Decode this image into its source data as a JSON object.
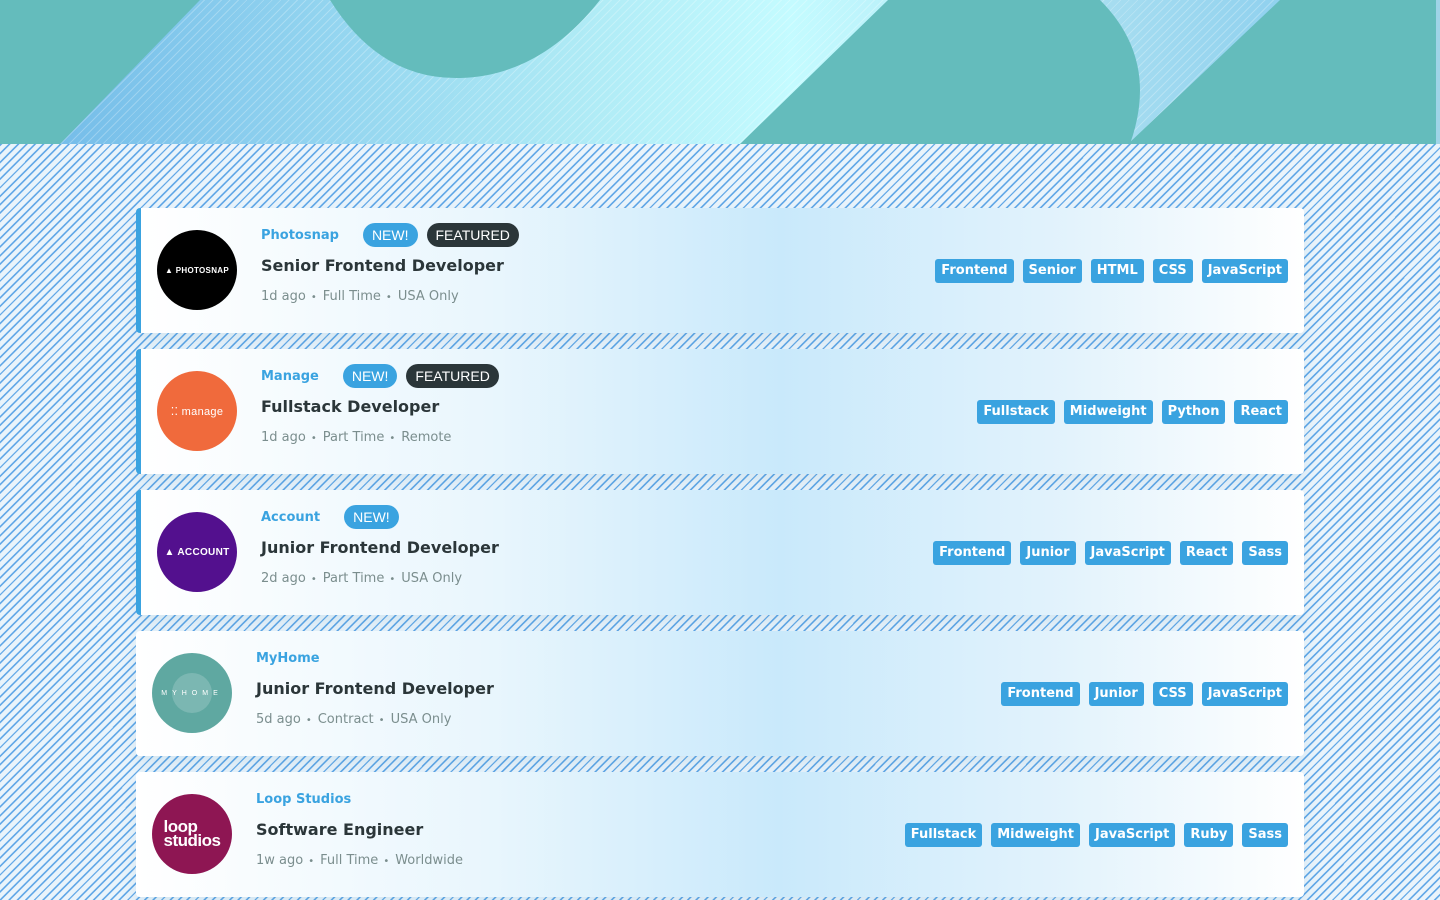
{
  "colors": {
    "accent": "#3aa3e0",
    "dark": "#2b3639",
    "muted": "#7b8e8e",
    "header_teal": "#64bcbc"
  },
  "jobs": [
    {
      "company": "Photosnap",
      "logo_text": "▲ PHOTOSNAP",
      "new_badge": "NEW!",
      "featured_badge": "FEATURED",
      "position": "Senior Frontend Developer",
      "posted": "1d ago",
      "contract": "Full Time",
      "location": "USA Only",
      "tags": [
        "Frontend",
        "Senior",
        "HTML",
        "CSS",
        "JavaScript"
      ]
    },
    {
      "company": "Manage",
      "logo_text": "⁚⁚ manage",
      "new_badge": "NEW!",
      "featured_badge": "FEATURED",
      "position": "Fullstack Developer",
      "posted": "1d ago",
      "contract": "Part Time",
      "location": "Remote",
      "tags": [
        "Fullstack",
        "Midweight",
        "Python",
        "React"
      ]
    },
    {
      "company": "Account",
      "logo_text": "▲ ACCOUNT",
      "new_badge": "NEW!",
      "position": "Junior Frontend Developer",
      "posted": "2d ago",
      "contract": "Part Time",
      "location": "USA Only",
      "tags": [
        "Frontend",
        "Junior",
        "JavaScript",
        "React",
        "Sass"
      ]
    },
    {
      "company": "MyHome",
      "logo_text": "MYHOME",
      "position": "Junior Frontend Developer",
      "posted": "5d ago",
      "contract": "Contract",
      "location": "USA Only",
      "tags": [
        "Frontend",
        "Junior",
        "CSS",
        "JavaScript"
      ]
    },
    {
      "company": "Loop Studios",
      "logo_text": "loop studios",
      "position": "Software Engineer",
      "posted": "1w ago",
      "contract": "Full Time",
      "location": "Worldwide",
      "tags": [
        "Fullstack",
        "Midweight",
        "JavaScript",
        "Ruby",
        "Sass"
      ]
    }
  ]
}
